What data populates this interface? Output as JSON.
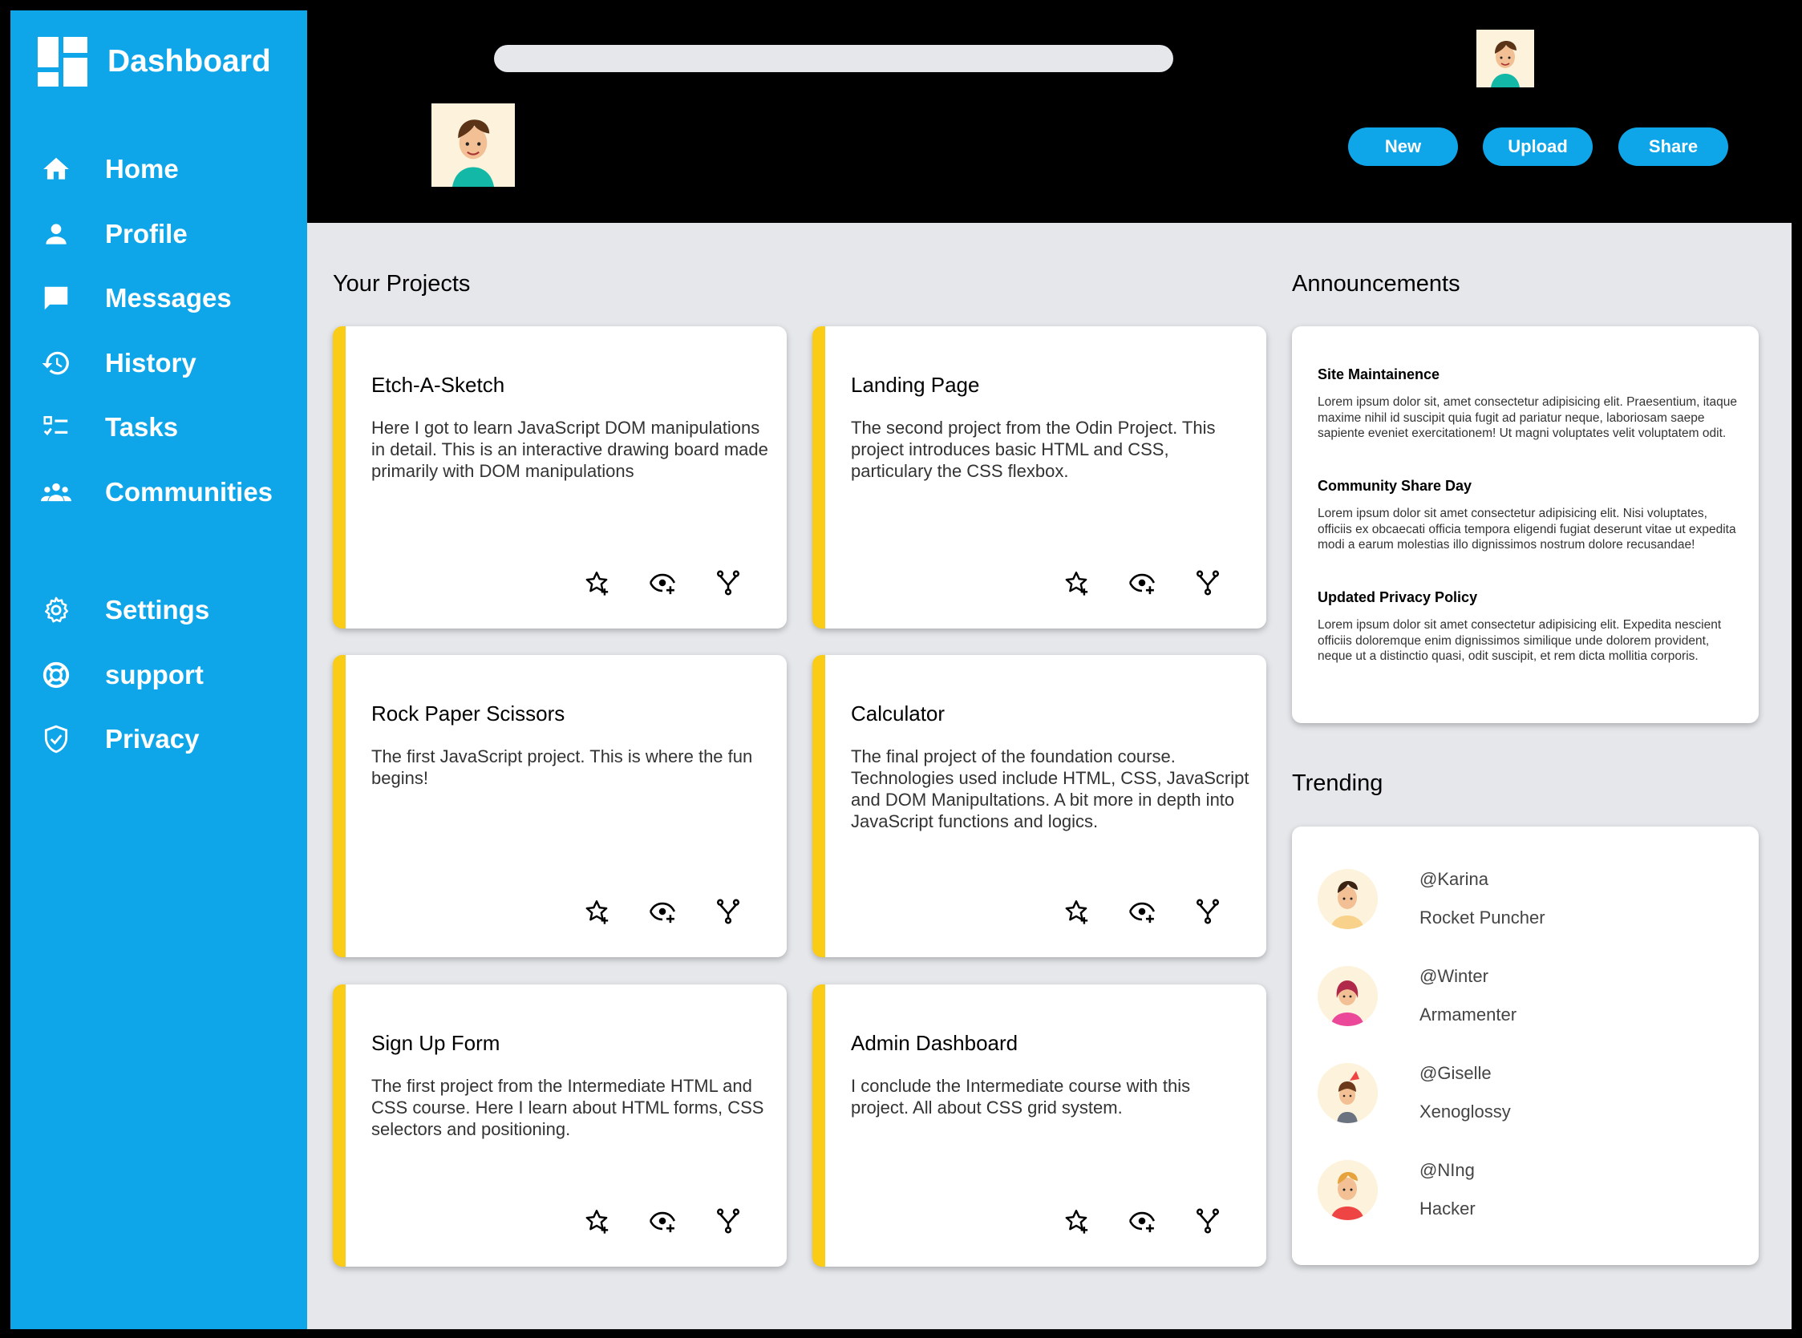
{
  "sidebar": {
    "brand": "Dashboard",
    "items": [
      {
        "label": "Home",
        "icon": "home-icon"
      },
      {
        "label": "Profile",
        "icon": "profile-icon"
      },
      {
        "label": "Messages",
        "icon": "message-icon"
      },
      {
        "label": "History",
        "icon": "history-icon"
      },
      {
        "label": "Tasks",
        "icon": "tasks-icon"
      },
      {
        "label": "Communities",
        "icon": "communities-icon"
      }
    ],
    "secondary": [
      {
        "label": "Settings",
        "icon": "gear-icon"
      },
      {
        "label": "support",
        "icon": "lifebuoy-icon"
      },
      {
        "label": "Privacy",
        "icon": "shield-icon"
      }
    ]
  },
  "header": {
    "search_placeholder": "",
    "buttons": {
      "new": "New",
      "upload": "Upload",
      "share": "Share"
    }
  },
  "projects": {
    "title": "Your Projects",
    "cards": [
      {
        "title": "Etch-A-Sketch",
        "description": "Here I got to learn JavaScript DOM manipulations in detail. This is an interactive drawing board made primarily with DOM manipulations"
      },
      {
        "title": "Landing Page",
        "description": "The second project from the Odin Project. This project introduces basic HTML and CSS, particulary the CSS flexbox."
      },
      {
        "title": "Rock Paper Scissors",
        "description": "The first JavaScript project. This is where the fun begins!"
      },
      {
        "title": "Calculator",
        "description": "The final project of the foundation course. Technologies used include HTML, CSS, JavaScript and DOM Manipultations. A bit more in depth into JavaScript functions and logics."
      },
      {
        "title": "Sign Up Form",
        "description": "The first project from the Intermediate HTML and CSS course. Here I learn about HTML forms, CSS selectors and positioning."
      },
      {
        "title": "Admin Dashboard",
        "description": "I conclude the Intermediate course with this project. All about CSS grid system."
      }
    ]
  },
  "announcements": {
    "title": "Announcements",
    "items": [
      {
        "title": "Site Maintainence",
        "body": "Lorem ipsum dolor sit, amet consectetur adipisicing elit. Praesentium, itaque maxime nihil id suscipit quia fugit ad pariatur neque, laboriosam saepe sapiente eveniet exercitationem! Ut magni voluptates velit voluptatem odit."
      },
      {
        "title": "Community Share Day",
        "body": "Lorem ipsum dolor sit amet consectetur adipisicing elit. Nisi voluptates, officiis ex obcaecati officia tempora eligendi fugiat deserunt vitae ut expedita modi a earum molestias illo dignissimos nostrum dolore recusandae!"
      },
      {
        "title": "Updated Privacy Policy",
        "body": "Lorem ipsum dolor sit amet consectetur adipisicing elit. Expedita nescient officiis doloremque enim dignissimos similique unde dolorem provident, neque ut a distinctio quasi, odit suscipit, et rem dicta mollitia corporis."
      }
    ]
  },
  "trending": {
    "title": "Trending",
    "items": [
      {
        "handle": "@Karina",
        "project": "Rocket Puncher"
      },
      {
        "handle": "@Winter",
        "project": "Armamenter"
      },
      {
        "handle": "@Giselle",
        "project": "Xenoglossy"
      },
      {
        "handle": "@NIng",
        "project": "Hacker"
      }
    ]
  },
  "colors": {
    "accent": "#0ea5e9",
    "card_stripe": "#facc15",
    "background": "#e5e7eb",
    "header": "#000000"
  }
}
